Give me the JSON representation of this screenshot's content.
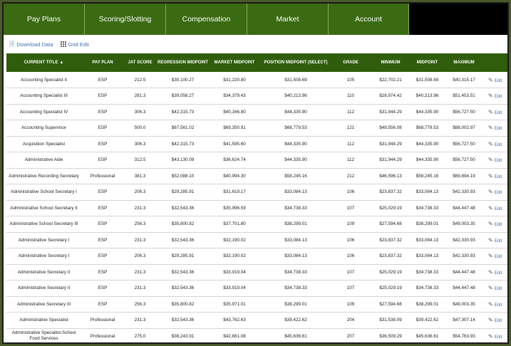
{
  "nav": {
    "tabs": [
      "Pay Plans",
      "Scoring/Slotting",
      "Compensation",
      "Market",
      "Account"
    ]
  },
  "toolbar": {
    "download_label": "Download Data",
    "grid_edit_label": "Grid Edit"
  },
  "table": {
    "columns": [
      "CURRENT TITLE",
      "PAY PLAN",
      "JAT SCORE",
      "REGRESSION MIDPOINT",
      "MARKET MIDPOINT",
      "POSITION MIDPOINT (SELECT)",
      "GRADE",
      "MINIMUM",
      "MIDPOINT",
      "MAXIMUM"
    ],
    "sort_indicator": "▲",
    "edit_label": "Edit",
    "rows": [
      [
        "Accounting Specialist II",
        "ESP",
        "212.5",
        "$30,100.27",
        "$31,220.80",
        "$31,508.69",
        "105",
        "$22,702.21",
        "$31,508.69",
        "$40,315.17"
      ],
      [
        "Accounting Specialist III",
        "ESP",
        "281.3",
        "$39,058.27",
        "$34,379.43",
        "$40,213.96",
        "110",
        "$28,974.42",
        "$40,213.96",
        "$51,453.51"
      ],
      [
        "Accounting Specialist IV",
        "ESP",
        "306.3",
        "$42,315.73",
        "$40,166.80",
        "$44,335.90",
        "112",
        "$31,944.29",
        "$44,335.90",
        "$56,727.50"
      ],
      [
        "Accounting Supervisor",
        "ESP",
        "500.0",
        "$67,561.02",
        "$69,350.91",
        "$68,779.53",
        "121",
        "$49,556.08",
        "$68,779.53",
        "$88,002.97"
      ],
      [
        "Acquisition Specialist",
        "ESP",
        "306.3",
        "$42,315.73",
        "$41,595.60",
        "$44,335.90",
        "112",
        "$31,944.29",
        "$44,335.90",
        "$56,727.50"
      ],
      [
        "Administrative Aide",
        "ESP",
        "312.5",
        "$43,130.09",
        "$36,624.74",
        "$44,335.90",
        "112",
        "$31,944.29",
        "$44,335.90",
        "$56,727.50"
      ],
      [
        "Administrative Recording Secretary",
        "Professional",
        "381.3",
        "$52,088.10",
        "$40,994.30",
        "$58,245.16",
        "212",
        "$46,596.13",
        "$58,245.16",
        "$69,894.19"
      ],
      [
        "Administrative School Secretary I",
        "ESP",
        "206.3",
        "$29,285.91",
        "$31,619.17",
        "$33,084.13",
        "106",
        "$23,837.32",
        "$33,084.13",
        "$42,330.93"
      ],
      [
        "Administrative School Secretary II",
        "ESP",
        "231.3",
        "$32,543.36",
        "$35,996.59",
        "$34,738.33",
        "107",
        "$25,029.19",
        "$34,738.33",
        "$44,447.48"
      ],
      [
        "Administrative School Secretary III",
        "ESP",
        "256.3",
        "$35,800.82",
        "$37,701.80",
        "$38,299.01",
        "109",
        "$27,594.68",
        "$38,299.01",
        "$49,003.35"
      ],
      [
        "Administrative Secretary I",
        "ESP",
        "231.3",
        "$32,543.36",
        "$32,190.02",
        "$33,084.13",
        "106",
        "$23,837.32",
        "$33,084.13",
        "$42,330.93"
      ],
      [
        "Administrative Secretary I",
        "ESP",
        "206.3",
        "$29,285.91",
        "$32,190.02",
        "$33,084.13",
        "106",
        "$23,837.32",
        "$33,084.13",
        "$42,330.93"
      ],
      [
        "Administrative Secretary II",
        "ESP",
        "231.3",
        "$32,543.36",
        "$33,919.04",
        "$34,738.33",
        "107",
        "$25,029.19",
        "$34,738.33",
        "$44,447.48"
      ],
      [
        "Administrative Secretary II",
        "ESP",
        "231.3",
        "$32,543.36",
        "$33,919.04",
        "$34,738.33",
        "107",
        "$25,029.19",
        "$34,738.33",
        "$44,447.48"
      ],
      [
        "Administrative Secretary III",
        "ESP",
        "256.3",
        "$35,800.82",
        "$35,971.01",
        "$38,299.01",
        "109",
        "$27,594.68",
        "$38,299.01",
        "$49,003.35"
      ],
      [
        "Administrative Specialist",
        "Professional",
        "231.3",
        "$32,543.36",
        "$43,762.63",
        "$39,422.62",
        "204",
        "$31,538.09",
        "$39,422.62",
        "$47,307.14"
      ],
      [
        "Administrative Specialist-School Food Services",
        "Professional",
        "275.0",
        "$38,243.91",
        "$42,861.08",
        "$45,636.61",
        "207",
        "$36,509.29",
        "$45,636.61",
        "$54,763.93"
      ]
    ]
  }
}
